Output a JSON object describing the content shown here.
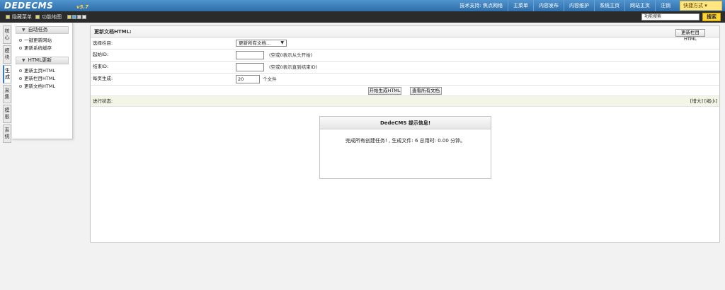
{
  "brand": {
    "logo": "DEDECMS",
    "version": "v5.7"
  },
  "topnav": {
    "items": [
      "技术支持: 焦点网络",
      "主菜单",
      "内容发布",
      "内容维护",
      "系统主页",
      "网站主页",
      "注销"
    ],
    "quick_label": "快捷方式 ▾"
  },
  "toolbar": {
    "hide_menu": "隐藏菜单",
    "function_map": "功能地图",
    "search_value": "功能搜索",
    "search_button": "搜索"
  },
  "left_tabs": [
    "核心",
    "模块",
    "生成",
    "采集",
    "模板",
    "系统"
  ],
  "left_menu": {
    "group1": {
      "title": "自动任务",
      "items": [
        "一键更新网站",
        "更新系统缓存"
      ]
    },
    "group2": {
      "title": "HTML更新",
      "items": [
        "更新主页HTML",
        "更新栏目HTML",
        "更新文档HTML"
      ]
    }
  },
  "form": {
    "title": "更新文档HTML:",
    "update_column_button": "更新栏目HTML",
    "select_column_label": "选择栏目:",
    "select_column_value": "更新所有文档...",
    "start_id_label": "起始ID:",
    "start_id_hint": "(空或0表示从头开始)",
    "end_id_label": "结束ID:",
    "end_id_hint": "(空或0表示直到结束ID)",
    "per_page_label": "每页生成:",
    "per_page_value": "20",
    "per_page_unit": "个文件",
    "start_button": "开始生成HTML",
    "view_button": "查看所有文档",
    "status_label": "进行状态:",
    "zoom": "[增大] [缩小]"
  },
  "message": {
    "title": "DedeCMS 提示信息!",
    "body": "完成所有创建任务! , 生成文件: 6 总用时: 0.00 分钟。"
  }
}
